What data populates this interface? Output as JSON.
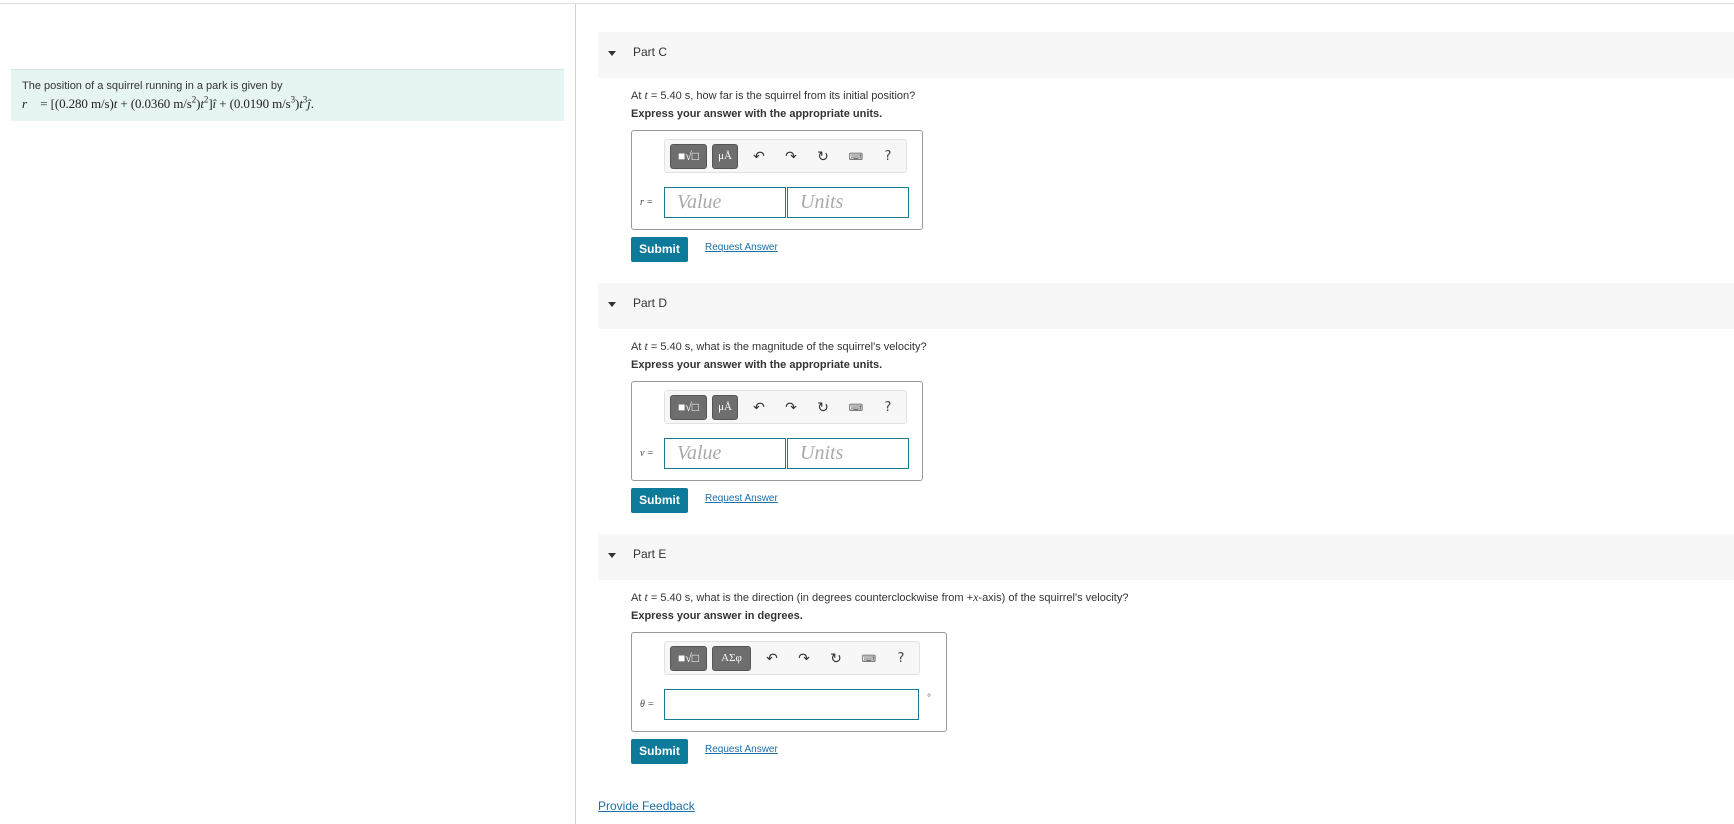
{
  "problem": {
    "text": "The position of a squirrel running in a park is given by",
    "eq_vec": "r⃗",
    "eq_part1": " = [(0.280 m/s)",
    "eq_t1": "t",
    "eq_part2": " + (0.0360 m/s",
    "eq_sup1": "2",
    "eq_part3": ")",
    "eq_t2": "t",
    "eq_sup2": "2",
    "eq_part4": "]",
    "eq_i": "î",
    "eq_part5": " + (0.0190 m/s",
    "eq_sup3": "3",
    "eq_part6": ")",
    "eq_t3": "t",
    "eq_sup4": "3",
    "eq_j": "ĵ",
    "eq_end": "."
  },
  "toolbar": {
    "templates_a": "■√□",
    "symbols_a": "μÅ",
    "templates_e": "■√□",
    "symbols_e": "ΑΣφ",
    "undo": "↶",
    "redo": "↷",
    "reset": "↻",
    "keyboard": "⌨",
    "help": "?"
  },
  "parts": [
    {
      "title": "Part C",
      "question_pre": "At ",
      "question_var": "t",
      "question_post": " = 5.40 s, how far is the squirrel from its initial position?",
      "instruction": "Express your answer with the appropriate units.",
      "var_label": "r =",
      "value_placeholder": "Value",
      "units_placeholder": "Units",
      "submit": "Submit",
      "request": "Request Answer"
    },
    {
      "title": "Part D",
      "question_pre": "At ",
      "question_var": "t",
      "question_post": " = 5.40 s, what is the magnitude of the squirrel's velocity?",
      "instruction": "Express your answer with the appropriate units.",
      "var_label": "v =",
      "value_placeholder": "Value",
      "units_placeholder": "Units",
      "submit": "Submit",
      "request": "Request Answer"
    },
    {
      "title": "Part E",
      "question_pre": "At ",
      "question_var": "t",
      "question_mid": " = 5.40 s, what is the direction (in degrees counterclockwise from +",
      "question_var2": "x",
      "question_post": "-axis) of the squirrel's velocity?",
      "instruction": "Express your answer in degrees.",
      "var_label": "θ =",
      "unit_symbol": "°",
      "submit": "Submit",
      "request": "Request Answer"
    }
  ],
  "feedback": "Provide Feedback",
  "colors": {
    "accent": "#0d7a99",
    "link": "#1a6fa8",
    "problem_bg": "#e6f4f4",
    "part_header_bg": "#f7f7f7"
  }
}
